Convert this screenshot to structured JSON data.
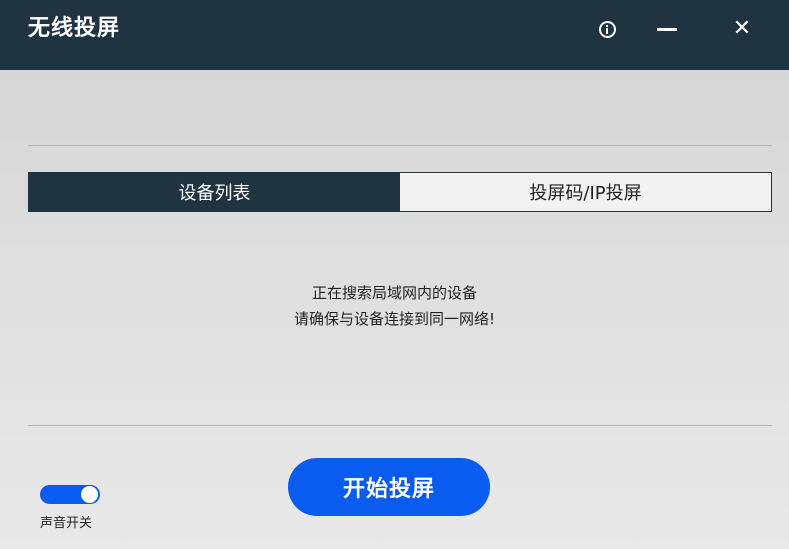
{
  "window": {
    "title": "无线投屏",
    "controls": {
      "info_icon": "info-circle-icon",
      "minimize_icon": "minus-icon",
      "close_symbol": "✕"
    }
  },
  "tabs": [
    {
      "label": "设备列表",
      "active": true
    },
    {
      "label": "投屏码/IP投屏",
      "active": false
    }
  ],
  "status": {
    "line1": "正在搜索局域网内的设备",
    "line2": "请确保与设备连接到同一网络!"
  },
  "actions": {
    "start_label": "开始投屏"
  },
  "sound": {
    "label": "声音开关",
    "enabled": true
  },
  "colors": {
    "titlebar": "#1f3340",
    "accent": "#0a5cf0",
    "tab_active": "#1f3340"
  }
}
